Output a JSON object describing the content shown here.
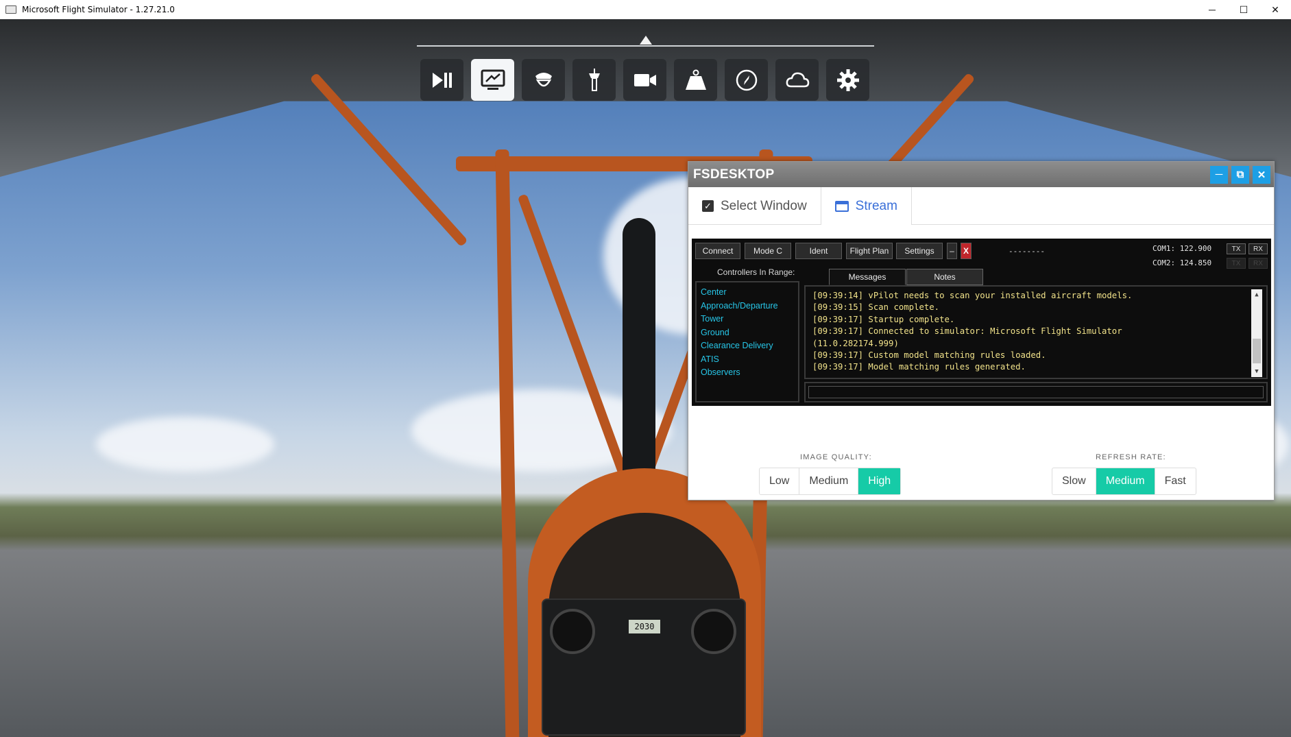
{
  "window": {
    "title": "Microsoft Flight Simulator - 1.27.21.0",
    "minimize": "─",
    "maximize": "☐",
    "close": "✕"
  },
  "toolbar": {
    "items": [
      {
        "icon": "pause-play-icon"
      },
      {
        "icon": "desktop-screen-icon",
        "active": true
      },
      {
        "icon": "pilot-icon"
      },
      {
        "icon": "control-tower-icon"
      },
      {
        "icon": "camera-icon"
      },
      {
        "icon": "weight-icon"
      },
      {
        "icon": "compass-icon"
      },
      {
        "icon": "cloud-icon"
      },
      {
        "icon": "gear-icon"
      }
    ]
  },
  "cockpit": {
    "lcd_value": "2030"
  },
  "fsdesktop": {
    "title": "FSDESKTOP",
    "tabs": {
      "select_window": "Select Window",
      "stream": "Stream"
    },
    "vpilot": {
      "buttons": {
        "connect": "Connect",
        "mode_c": "Mode C",
        "ident": "Ident",
        "flight_plan": "Flight Plan",
        "settings": "Settings",
        "minimize": "–",
        "close": "X"
      },
      "status": "--------",
      "com1": "COM1: 122.900",
      "com2": "COM2: 124.850",
      "tx": "TX",
      "rx": "RX",
      "controllers_label": "Controllers In Range:",
      "controllers": [
        "Center",
        "Approach/Departure",
        "Tower",
        "Ground",
        "Clearance Delivery",
        "ATIS",
        "Observers"
      ],
      "tabs": {
        "messages": "Messages",
        "notes": "Notes"
      },
      "messages": [
        "[09:39:14] vPilot needs to scan your installed aircraft models.",
        "[09:39:15] Scan complete.",
        "[09:39:17] Startup complete.",
        "[09:39:17] Connected to simulator: Microsoft Flight Simulator",
        "(11.0.282174.999)",
        "[09:39:17] Custom model matching rules loaded.",
        "[09:39:17] Model matching rules generated."
      ]
    },
    "image_quality": {
      "label": "IMAGE QUALITY:",
      "options": [
        "Low",
        "Medium",
        "High"
      ],
      "selected": "High"
    },
    "refresh_rate": {
      "label": "REFRESH RATE:",
      "options": [
        "Slow",
        "Medium",
        "Fast"
      ],
      "selected": "Medium"
    },
    "accent_color": "#16cba7"
  }
}
